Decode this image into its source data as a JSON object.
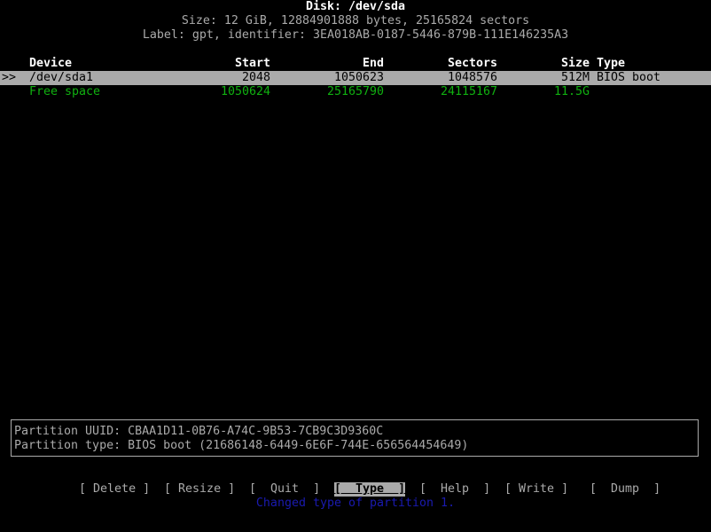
{
  "header": {
    "disk_title": "Disk: /dev/sda",
    "size_line": "Size: 12 GiB, 12884901888 bytes, 25165824 sectors",
    "label_line": "Label: gpt, identifier: 3EA018AB-0187-5446-879B-111E146235A3"
  },
  "table": {
    "columns": {
      "device": "Device",
      "start": "Start",
      "end": "End",
      "sectors": "Sectors",
      "size": "Size",
      "type": "Type"
    },
    "rows": [
      {
        "cursor": ">>",
        "device": "/dev/sda1",
        "start": "2048",
        "end": "1050623",
        "sectors": "1048576",
        "size": "512M",
        "type": "BIOS boot"
      },
      {
        "cursor": "",
        "device": "Free space",
        "start": "1050624",
        "end": "25165790",
        "sectors": "24115167",
        "size": "11.5G",
        "type": ""
      }
    ]
  },
  "info": {
    "uuid_line": "Partition UUID: CBAA1D11-0B76-A74C-9B53-7CB9C3D9360C",
    "type_line": "Partition type: BIOS boot (21686148-6449-6E6F-744E-656564454649)"
  },
  "menu": {
    "delete": {
      "open": "[",
      "label": " Delete ",
      "close": "]"
    },
    "resize": {
      "open": "[",
      "label": " Resize ",
      "close": "]"
    },
    "quit": {
      "open": "[",
      "label": "  Quit  ",
      "close": "]"
    },
    "type": {
      "open": "[",
      "label": "  Type  ",
      "close": "]"
    },
    "help": {
      "open": "[",
      "label": "  Help  ",
      "close": "]"
    },
    "write": {
      "open": "[",
      "label": " Write ",
      "close": "]"
    },
    "dump": {
      "open": "[",
      "label": "  Dump  ",
      "close": "]"
    }
  },
  "status_message": "Changed type of partition 1.",
  "colors": {
    "background": "#000000",
    "text": "#aaaaaa",
    "selected_bar": "#aaaaaa",
    "free_space": "#10b010",
    "status": "#1a1ab0"
  }
}
